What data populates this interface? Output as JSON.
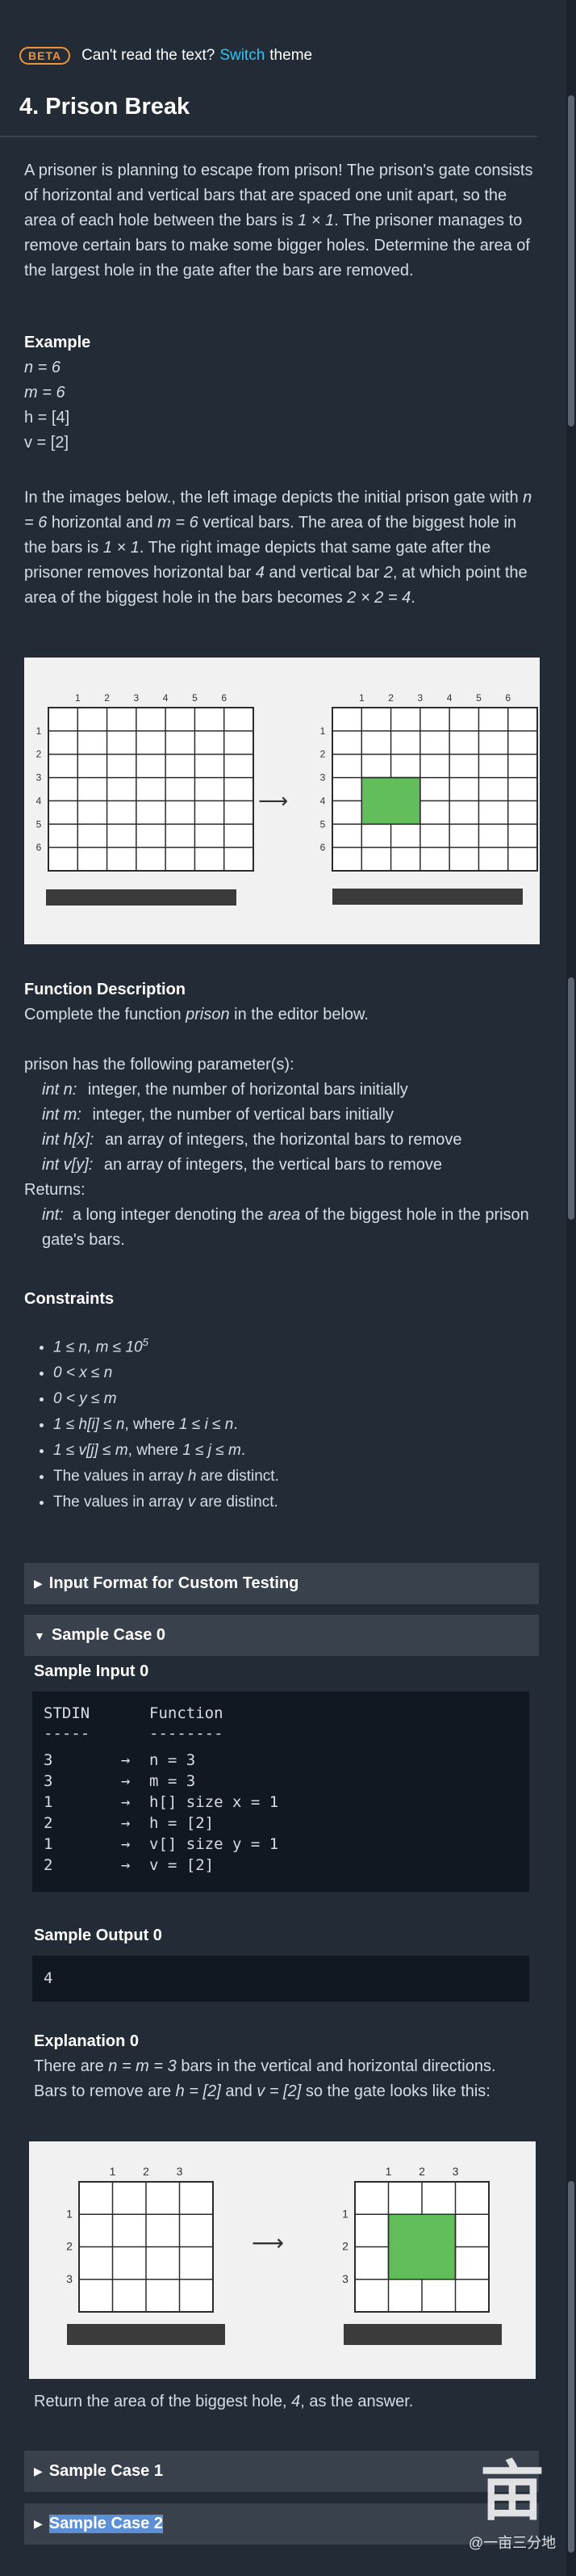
{
  "banner": {
    "badge": "BETA",
    "pre": "Can't read the text?",
    "link": "Switch",
    "post": "theme"
  },
  "title": "4. Prison Break",
  "intro": {
    "s1": "A prisoner is planning to escape from prison! The prison's gate consists of horizontal and vertical bars that are spaced one unit apart, so the area of each hole between the bars is ",
    "unit": "1 × 1",
    "s2": ". The prisoner manages to remove certain bars to make some bigger holes. Determine the area of the largest hole in the gate after the bars are removed."
  },
  "example": {
    "heading": "Example",
    "n": "n = 6",
    "m": "m = 6",
    "h": "h = [4]",
    "v": "v = [2]"
  },
  "images_desc": {
    "p1": "In the images below., the left image depicts the initial prison gate with ",
    "n": "n = 6",
    "p2": " horizontal and ",
    "m": "m = 6",
    "p3": " vertical bars. The area of the biggest hole in the bars is ",
    "a1": "1 × 1",
    "p4": ". The right image depicts that same gate after the prisoner removes horizontal bar ",
    "h4": "4",
    "p5": " and vertical bar ",
    "v2": "2",
    "p6": ", at which point the area of the biggest hole in the bars becomes ",
    "a2": "2 × 2 = 4",
    "p7": "."
  },
  "figure1": {
    "col_labels": [
      "1",
      "2",
      "3",
      "4",
      "5",
      "6"
    ],
    "row_labels": [
      "1",
      "2",
      "3",
      "4",
      "5",
      "6"
    ],
    "arrow": "⟶"
  },
  "function_desc": {
    "heading": "Function Description",
    "line_pre": "Complete the function ",
    "fname": "prison",
    "line_post": " in the editor below.",
    "params_intro": "prison has the following parameter(s):",
    "params": [
      {
        "name": "int n:",
        "desc": "integer, the number of horizontal bars initially"
      },
      {
        "name": "int m:",
        "desc": "integer, the number of vertical bars initially"
      },
      {
        "name": "int h[x]:",
        "desc": "an array of integers, the horizontal bars to remove"
      },
      {
        "name": "int v[y]:",
        "desc": "an array of integers, the vertical bars to remove"
      }
    ],
    "returns_label": "Returns:",
    "returns_type": "int:",
    "returns_pre": "a long integer denoting the ",
    "returns_area": "area",
    "returns_post": " of the biggest hole in the prison gate's bars."
  },
  "constraints": {
    "heading": "Constraints",
    "c1_base": "1 ≤ n, m ≤ 10",
    "c1_exp": "5",
    "c2": "0 < x ≤ n",
    "c3": "0 < y ≤ m",
    "c4_a": "1 ≤ h[i] ≤ n",
    "c4_b": ", where ",
    "c4_c": "1 ≤ i ≤ n",
    "c4_d": ".",
    "c5_a": "1 ≤ v[j] ≤ m",
    "c5_b": ", where ",
    "c5_c": "1 ≤ j ≤ m",
    "c5_d": ".",
    "c6_a": "The values in array ",
    "c6_b": "h",
    "c6_c": " are distinct.",
    "c7_a": "The values in array ",
    "c7_b": "v",
    "c7_c": " are distinct."
  },
  "sections": {
    "input_format": "Input Format for Custom Testing",
    "sample0": "Sample Case 0",
    "sample1": "Sample Case 1",
    "sample2": "Sample Case 2",
    "arrow_closed": "▶",
    "arrow_open": "▼"
  },
  "sample0": {
    "input_heading": "Sample Input 0",
    "header": {
      "c1": "STDIN",
      "c3": "Function"
    },
    "sep": {
      "c1": "-----",
      "c3": "--------"
    },
    "rows": [
      {
        "c1": "3",
        "c2": "→",
        "c3": "n = 3"
      },
      {
        "c1": "3",
        "c2": "→",
        "c3": "m = 3"
      },
      {
        "c1": "1",
        "c2": "→",
        "c3": "h[] size x = 1"
      },
      {
        "c1": "2",
        "c2": "→",
        "c3": "h = [2]"
      },
      {
        "c1": "1",
        "c2": "→",
        "c3": "v[] size y = 1"
      },
      {
        "c1": "2",
        "c2": "→",
        "c3": "v = [2]"
      }
    ],
    "output_heading": "Sample Output 0",
    "output_value": "4",
    "explanation_heading": "Explanation 0",
    "exp_p1": "There are ",
    "exp_nm": "n = m = 3",
    "exp_p2": " bars in the vertical and horizontal directions. Bars to remove are ",
    "exp_h": "h = [2]",
    "exp_p3": " and ",
    "exp_v": "v = [2]",
    "exp_p4": " so the gate looks like this:",
    "return_pre": "Return the area of the biggest hole, ",
    "return_val": "4",
    "return_post": ", as the answer."
  },
  "figure2": {
    "col_labels": [
      "1",
      "2",
      "3"
    ],
    "row_labels": [
      "1",
      "2",
      "3"
    ],
    "arrow": "⟶"
  },
  "watermark": {
    "glyph": "亩",
    "text": "@一亩三分地"
  },
  "colors": {
    "background": "#232b36",
    "text": "#d7dde5",
    "accent_link": "#2ec4f3",
    "beta_orange": "#f0933b",
    "hole_green": "#62bd5b",
    "section_bar": "#39414d",
    "code_bg": "#121821"
  }
}
